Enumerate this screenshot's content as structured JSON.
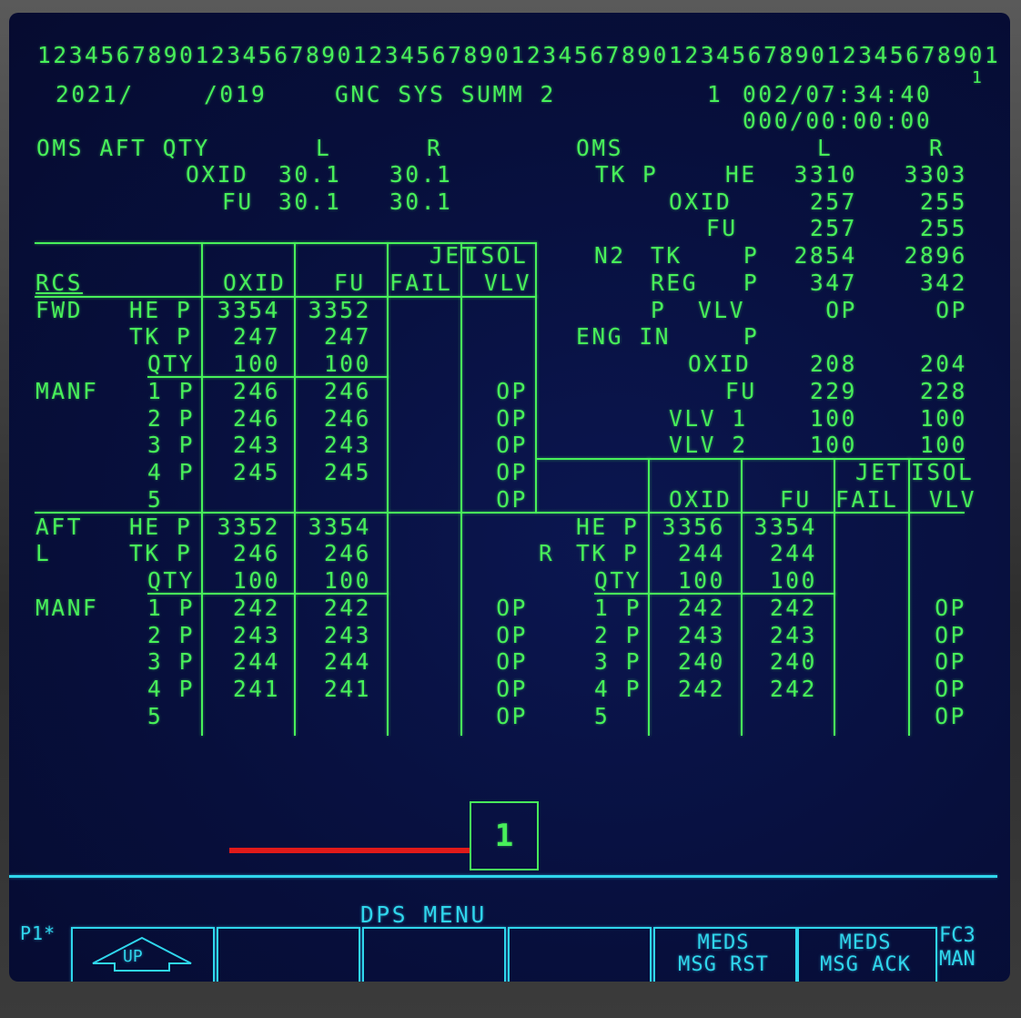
{
  "header": {
    "ruler": "1234567890123456789012345678901234567890123456789012345678901",
    "ruler_sup": "1",
    "ops_id": "2021/",
    "spec": "/019",
    "title": "GNC SYS SUMM 2",
    "crt": "1",
    "met": "002/07:34:40",
    "timer": "000/00:00:00"
  },
  "oms_aft_qty": {
    "heading": "OMS AFT QTY",
    "col_l": "L",
    "col_r": "R",
    "oxid_label": "OXID",
    "oxid_l": "30.1",
    "oxid_r": "30.1",
    "fu_label": "FU",
    "fu_l": "30.1",
    "fu_r": "30.1"
  },
  "oms": {
    "heading": "OMS",
    "col_l": "L",
    "col_r": "R",
    "tk_p_label": "TK P",
    "he_label": "HE",
    "he_l": "3310",
    "he_r": "3303",
    "oxid_label": "OXID",
    "oxid_l": "257",
    "oxid_r": "255",
    "fu_label": "FU",
    "fu_l": "257",
    "fu_r": "255",
    "n2_label": "N2",
    "n2_tk_label": "TK",
    "n2_tk_p_label": "P",
    "n2_tk_l": "2854",
    "n2_tk_r": "2896",
    "reg_label": "REG",
    "reg_p_label": "P",
    "reg_l": "347",
    "reg_r": "342",
    "pvlv_label": "P  VLV",
    "pvlv_l": "OP",
    "pvlv_r": "OP",
    "eng_label": "ENG IN",
    "eng_p_label": "P",
    "eng_oxid_label": "OXID",
    "eng_oxid_l": "208",
    "eng_oxid_r": "204",
    "eng_fu_label": "FU",
    "eng_fu_l": "229",
    "eng_fu_r": "228",
    "vlv1_label": "VLV 1",
    "vlv1_l": "100",
    "vlv1_r": "100",
    "vlv2_label": "VLV 2",
    "vlv2_l": "100",
    "vlv2_r": "100"
  },
  "rcs_headers": {
    "rcs": "RCS",
    "oxid": "OXID",
    "fu": "FU",
    "jet": "JET",
    "fail": "FAIL",
    "isol": "ISOL",
    "vlv": "VLV"
  },
  "fwd": {
    "label": "FWD",
    "he_label": "HE P",
    "he_oxid": "3354",
    "he_fu": "3352",
    "tk_label": "TK P",
    "tk_oxid": "247",
    "tk_fu": "247",
    "qty_label": "QTY",
    "qty_oxid": "100",
    "qty_fu": "100",
    "manf_label": "MANF",
    "manf": [
      {
        "n": "1 P",
        "oxid": "246",
        "fu": "246",
        "vlv": "OP"
      },
      {
        "n": "2 P",
        "oxid": "246",
        "fu": "246",
        "vlv": "OP"
      },
      {
        "n": "3 P",
        "oxid": "243",
        "fu": "243",
        "vlv": "OP"
      },
      {
        "n": "4 P",
        "oxid": "245",
        "fu": "245",
        "vlv": "OP"
      },
      {
        "n": "5",
        "oxid": "",
        "fu": "",
        "vlv": "OP"
      }
    ]
  },
  "aft_l": {
    "label": "AFT",
    "side": "L",
    "he_label": "HE P",
    "he_oxid": "3352",
    "he_fu": "3354",
    "tk_label": "TK P",
    "tk_oxid": "246",
    "tk_fu": "246",
    "qty_label": "QTY",
    "qty_oxid": "100",
    "qty_fu": "100",
    "manf_label": "MANF",
    "manf": [
      {
        "n": "1 P",
        "oxid": "242",
        "fu": "242",
        "vlv": "OP"
      },
      {
        "n": "2 P",
        "oxid": "243",
        "fu": "243",
        "vlv": "OP"
      },
      {
        "n": "3 P",
        "oxid": "244",
        "fu": "244",
        "vlv": "OP"
      },
      {
        "n": "4 P",
        "oxid": "241",
        "fu": "241",
        "vlv": "OP"
      },
      {
        "n": "5",
        "oxid": "",
        "fu": "",
        "vlv": "OP"
      }
    ]
  },
  "aft_r": {
    "side": "R",
    "he_label": "HE P",
    "he_oxid": "3356",
    "he_fu": "3354",
    "tk_label": "TK P",
    "tk_oxid": "244",
    "tk_fu": "244",
    "qty_label": "QTY",
    "qty_oxid": "100",
    "qty_fu": "100",
    "manf": [
      {
        "n": "1 P",
        "oxid": "242",
        "fu": "242",
        "vlv": "OP"
      },
      {
        "n": "2 P",
        "oxid": "243",
        "fu": "243",
        "vlv": "OP"
      },
      {
        "n": "3 P",
        "oxid": "240",
        "fu": "240",
        "vlv": "OP"
      },
      {
        "n": "4 P",
        "oxid": "242",
        "fu": "242",
        "vlv": "OP"
      },
      {
        "n": "5",
        "oxid": "",
        "fu": "",
        "vlv": "OP"
      }
    ]
  },
  "fault": {
    "msg_count": "1"
  },
  "menu": {
    "title": "DPS MENU",
    "port": "P1*",
    "up_label": "UP",
    "meds_rst_l1": "MEDS",
    "meds_rst_l2": "MSG RST",
    "meds_ack_l1": "MEDS",
    "meds_ack_l2": "MSG ACK",
    "fc_l1": "FC3",
    "fc_l2": "MAN"
  },
  "colors": {
    "text": "#48f05a",
    "menu": "#2fd6ec",
    "alert_line": "#e01a1a",
    "background": "#070f3c"
  }
}
